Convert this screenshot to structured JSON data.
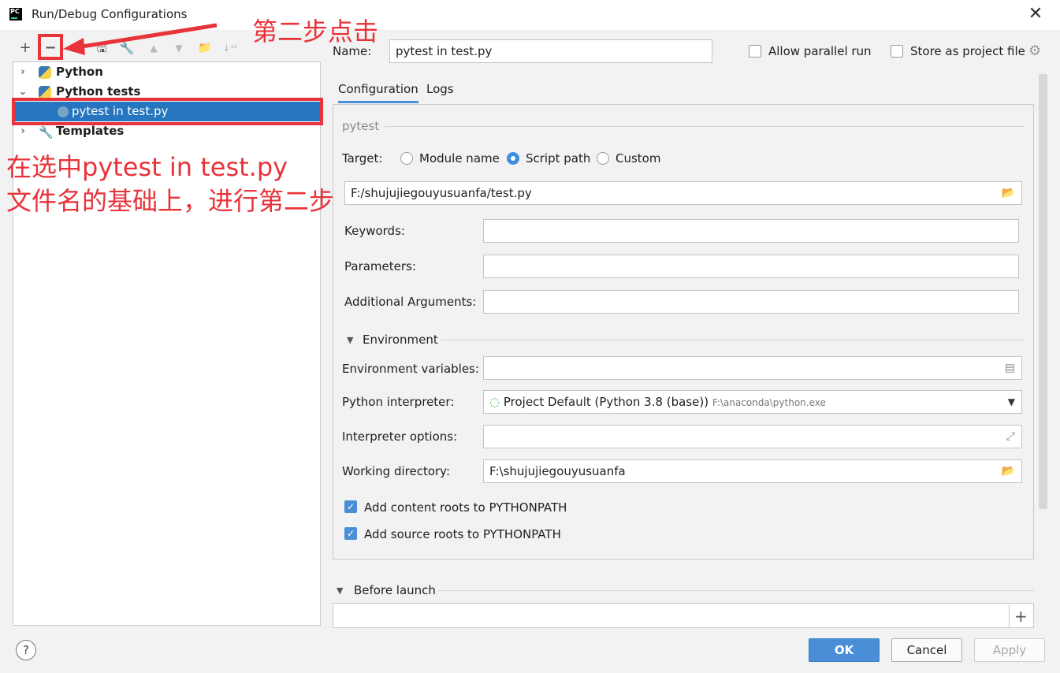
{
  "window": {
    "title": "Run/Debug Configurations",
    "app_icon_text": "PC",
    "close_symbol": "✕"
  },
  "toolbar": {
    "add": "+",
    "remove": "−",
    "copy": "⧉",
    "save": "🖫",
    "edit": "🔧",
    "up": "▲",
    "down": "▼",
    "folder": "📁",
    "sort": "↓ᵃᶻ"
  },
  "tree": {
    "items": [
      {
        "label": "Python",
        "level": 0
      },
      {
        "label": "Python tests",
        "level": 0
      },
      {
        "label": "pytest in test.py",
        "level": 1,
        "selected": true
      },
      {
        "label": "Templates",
        "level": 0
      }
    ]
  },
  "annotations": {
    "step2": "第二步点击",
    "line1": "在选中pytest in test.py",
    "line2": "文件名的基础上，进行第二步",
    "color": "#e8333a"
  },
  "form": {
    "name_label": "Name:",
    "name_value": "pytest in test.py",
    "allow_parallel": "Allow parallel run",
    "store_project": "Store as project file",
    "tabs": [
      "Configuration",
      "Logs"
    ],
    "section_pytest": "pytest",
    "target_label": "Target:",
    "target_options": [
      "Module name",
      "Script path",
      "Custom"
    ],
    "target_selected": "Script path",
    "script_path": "F:/shujujiegouyusuanfa/test.py",
    "keywords_label": "Keywords:",
    "keywords_value": "",
    "parameters_label": "Parameters:",
    "parameters_value": "",
    "additional_label": "Additional Arguments:",
    "additional_value": "",
    "environment_section": "Environment",
    "env_vars_label": "Environment variables:",
    "env_vars_value": "",
    "interpreter_label": "Python interpreter:",
    "interpreter_value": "Project Default (Python 3.8 (base))",
    "interpreter_path": "F:\\anaconda\\python.exe",
    "interp_options_label": "Interpreter options:",
    "interp_options_value": "",
    "workdir_label": "Working directory:",
    "workdir_value": "F:\\shujujiegouyusuanfa",
    "content_roots": "Add content roots to PYTHONPATH",
    "source_roots": "Add source roots to PYTHONPATH",
    "before_launch": "Before launch"
  },
  "buttons": {
    "ok": "OK",
    "cancel": "Cancel",
    "apply": "Apply",
    "help": "?"
  },
  "colors": {
    "accent": "#4a8ed8",
    "selection": "#2675bf"
  }
}
